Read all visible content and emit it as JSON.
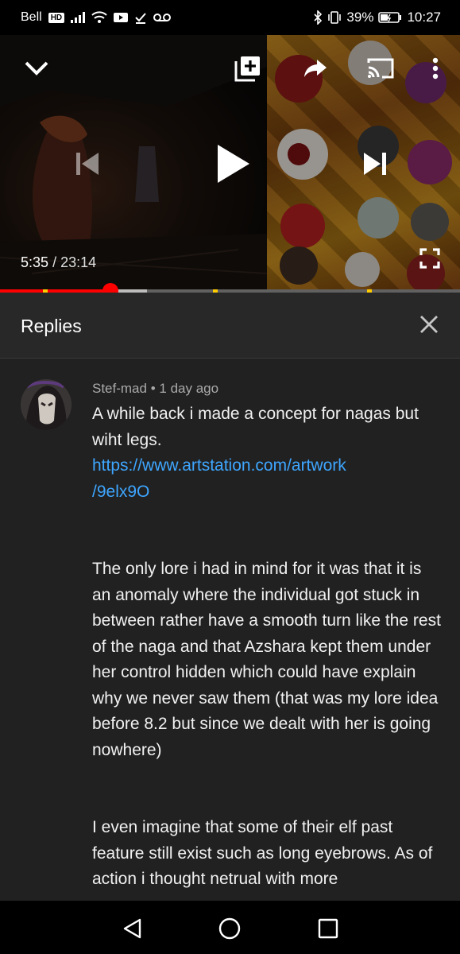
{
  "status_bar": {
    "carrier": "Bell",
    "hd_badge": "HD",
    "battery": "39%",
    "time": "10:27"
  },
  "player": {
    "current_time": "5:35",
    "separator": "/",
    "total_time": "23:14",
    "progress_played_fraction": 0.24,
    "progress_buffered_fraction": 0.32
  },
  "replies": {
    "title": "Replies"
  },
  "comment": {
    "author": "Stef-mad",
    "dot": "•",
    "age": "1 day ago",
    "paragraph1": "A while back i made a concept for nagas but wiht legs.",
    "link_line1": "https://www.artstation.com/artwork",
    "link_line2": "/9elx9O",
    "paragraph2": "The only lore i had in mind for it was that it is an anomaly where the individual got stuck in between rather have a smooth turn like the rest of the naga and that Azshara kept them under her control hidden which could have explain why we never saw them (that was my lore idea before 8.2  but since we dealt with her is going nowhere)",
    "paragraph3": "I even imagine that some of their elf past feature still exist such as long eyebrows. As of action i thought netrual with more"
  },
  "icons": {
    "collapse": "chevron-down-icon",
    "add_to_playlist": "playlist-add-icon",
    "share": "share-icon",
    "cast": "cast-icon",
    "more": "more-vert-icon",
    "previous": "skip-previous-icon",
    "play": "play-icon",
    "next": "skip-next-icon",
    "fullscreen": "fullscreen-icon",
    "close": "close-icon"
  },
  "colors": {
    "background": "#212121",
    "header": "#282828",
    "link": "#3ea6ff",
    "progress": "#ff0000",
    "meta": "#aaaaaa"
  }
}
